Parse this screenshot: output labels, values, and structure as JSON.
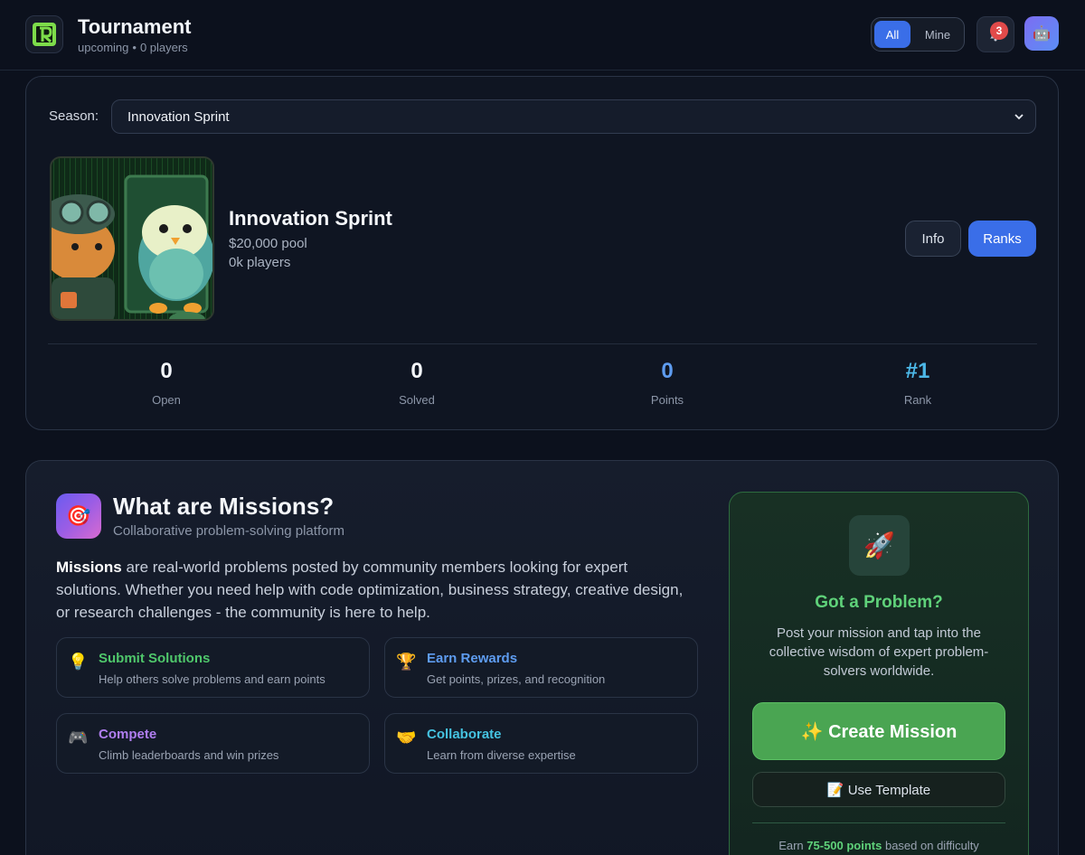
{
  "header": {
    "title": "Tournament",
    "status": "upcoming",
    "players": "0 players",
    "filter": {
      "all_label": "All",
      "mine_label": "Mine",
      "selected": "All"
    },
    "notifications_count": "3"
  },
  "season": {
    "label": "Season:",
    "selected": "Innovation Sprint",
    "name": "Innovation Sprint",
    "pool": "$20,000 pool",
    "players": "0k players",
    "info_label": "Info",
    "ranks_label": "Ranks",
    "stats": [
      {
        "value": "0",
        "label": "Open"
      },
      {
        "value": "0",
        "label": "Solved"
      },
      {
        "value": "0",
        "label": "Points"
      },
      {
        "value": "#1",
        "label": "Rank"
      }
    ]
  },
  "missions": {
    "title": "What are Missions?",
    "subtitle": "Collaborative problem-solving platform",
    "desc_bold": "Missions",
    "desc_rest": " are real-world problems posted by community members looking for expert solutions. Whether you need help with code optimization, business strategy, creative design, or research challenges - the community is here to help.",
    "features": [
      {
        "icon": "lightbulb-icon",
        "glyph": "💡",
        "title": "Submit Solutions",
        "desc": "Help others solve problems and earn points"
      },
      {
        "icon": "trophy-icon",
        "glyph": "🏆",
        "title": "Earn Rewards",
        "desc": "Get points, prizes, and recognition"
      },
      {
        "icon": "gamepad-icon",
        "glyph": "🎮",
        "title": "Compete",
        "desc": "Climb leaderboards and win prizes"
      },
      {
        "icon": "handshake-icon",
        "glyph": "🤝",
        "title": "Collaborate",
        "desc": "Learn from diverse expertise"
      }
    ],
    "cta": {
      "icon": "rocket-icon",
      "title": "Got a Problem?",
      "desc": "Post your mission and tap into the collective wisdom of expert problem-solvers worldwide.",
      "create_label": "✨ Create Mission",
      "template_label": "📝 Use Template",
      "earn_prefix": "Earn ",
      "earn_points": "75-500 points",
      "earn_suffix": " based on difficulty"
    }
  },
  "colors": {
    "background": "#0c111d",
    "accent_blue": "#3a6ee8",
    "green": "#4aa552",
    "badge_red": "#e24a4a"
  }
}
